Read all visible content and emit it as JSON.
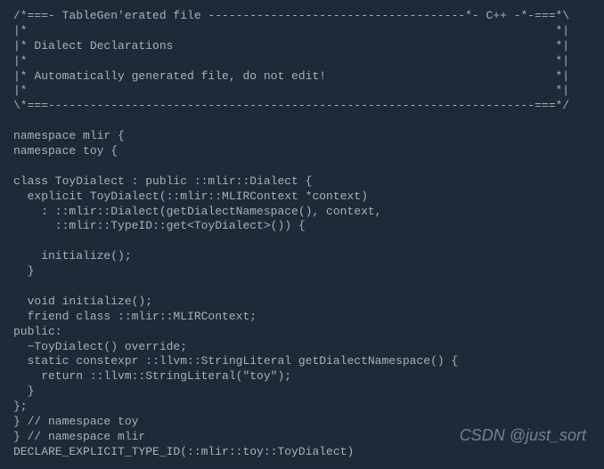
{
  "code": {
    "lines": [
      "/*===- TableGen'erated file -------------------------------------*- C++ -*-===*\\",
      "|*                                                                            *|",
      "|* Dialect Declarations                                                       *|",
      "|*                                                                            *|",
      "|* Automatically generated file, do not edit!                                 *|",
      "|*                                                                            *|",
      "\\*===----------------------------------------------------------------------===*/",
      "",
      "namespace mlir {",
      "namespace toy {",
      "",
      "class ToyDialect : public ::mlir::Dialect {",
      "  explicit ToyDialect(::mlir::MLIRContext *context)",
      "    : ::mlir::Dialect(getDialectNamespace(), context,",
      "      ::mlir::TypeID::get<ToyDialect>()) {",
      "    ",
      "    initialize();",
      "  }",
      "",
      "  void initialize();",
      "  friend class ::mlir::MLIRContext;",
      "public:",
      "  ~ToyDialect() override;",
      "  static constexpr ::llvm::StringLiteral getDialectNamespace() {",
      "    return ::llvm::StringLiteral(\"toy\");",
      "  }",
      "};",
      "} // namespace toy",
      "} // namespace mlir",
      "DECLARE_EXPLICIT_TYPE_ID(::mlir::toy::ToyDialect)"
    ]
  },
  "watermark": "CSDN @just_sort"
}
